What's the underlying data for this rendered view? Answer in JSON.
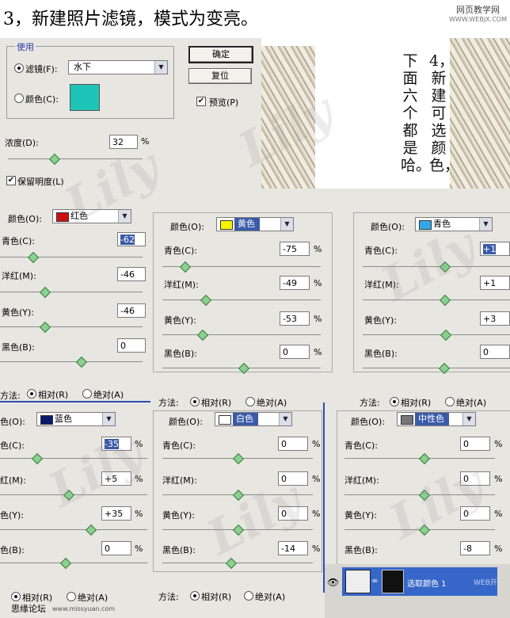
{
  "header": {
    "title": "3，新建照片滤镜，模式为变亮。",
    "brand": "网页教学网",
    "brand_url": "WWW.WEBJX.COM"
  },
  "photo_filter": {
    "group_label": "使用",
    "filter_label": "滤镜(F):",
    "filter_value": "水下",
    "color_label": "颜色(C):",
    "swatch_color": "#1ec4b8",
    "ok": "确定",
    "reset": "复位",
    "preview_label": "预览(P)",
    "preview_checked": true,
    "density_label": "浓度(D):",
    "density_value": "32",
    "density_unit": "%",
    "density": 0.32,
    "preserve_label": "保留明度(L)",
    "preserve_checked": true
  },
  "step4_text": {
    "col1": "4，新建可选颜色，",
    "col2": "下面六个都是哈。"
  },
  "labels": {
    "colors": "颜色(O):",
    "cyan": "青色(C):",
    "magenta": "洋红(M):",
    "yellow": "黄色(Y):",
    "black": "黑色(B):",
    "method": "方法:",
    "relative": "相对(R)",
    "absolute": "绝对(A)",
    "pct": "%",
    "colors_short": "色(O):",
    "cyan_short": "色(C):",
    "magenta_short": "红(M):",
    "yellow_short": "色(Y):",
    "black_short": "色(B):",
    "method_short": "方法:"
  },
  "panels": [
    {
      "color_name": "红色",
      "swatch": "#cc1111",
      "values": [
        "-62",
        "-46",
        "-46",
        "0"
      ],
      "selected": 0
    },
    {
      "color_name": "黄色",
      "swatch": "#f4f400",
      "values": [
        "-75",
        "-49",
        "-53",
        "0"
      ],
      "selected": -1
    },
    {
      "color_name": "青色",
      "swatch": "#33a8e8",
      "values": [
        "+1",
        "+1",
        "+3",
        "0"
      ],
      "selected": 0
    },
    {
      "color_name": "蓝色",
      "swatch": "#0a1a6a",
      "values": [
        "-35",
        "+5",
        "+35",
        "0"
      ],
      "selected": 0
    },
    {
      "color_name": "白色",
      "swatch": "#ffffff",
      "values": [
        "0",
        "0",
        "0",
        "-14"
      ],
      "selected": -1
    },
    {
      "color_name": "中性色",
      "swatch": "#777777",
      "values": [
        "0",
        "0",
        "0",
        "-8"
      ],
      "selected": -1
    }
  ],
  "layer": {
    "name": "选取颜色 1",
    "watermark": "WEB开"
  },
  "footer": {
    "site": "思缘论坛",
    "url": "www.missyuan.com"
  },
  "watermark_text": "Lily"
}
